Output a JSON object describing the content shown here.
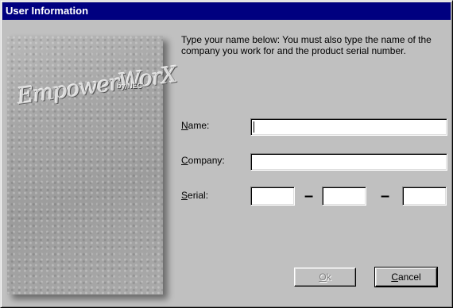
{
  "window": {
    "title": "User Information"
  },
  "logo": {
    "brand": "EmpowerWorX",
    "suffix": "by NEC"
  },
  "instructions": "Type your name below: You must also type the name of the company you work for and the product serial number.",
  "fields": {
    "name": {
      "label_first": "N",
      "label_rest": "ame:",
      "value": ""
    },
    "company": {
      "label_first": "C",
      "label_rest": "ompany:",
      "value": ""
    },
    "serial": {
      "label_first": "S",
      "label_rest": "erial:",
      "part1": "",
      "part2": "",
      "part3": ""
    },
    "separator": "–"
  },
  "buttons": {
    "ok": {
      "first": "O",
      "rest": "k",
      "enabled": false
    },
    "cancel": {
      "first": "C",
      "rest": "ancel"
    }
  }
}
